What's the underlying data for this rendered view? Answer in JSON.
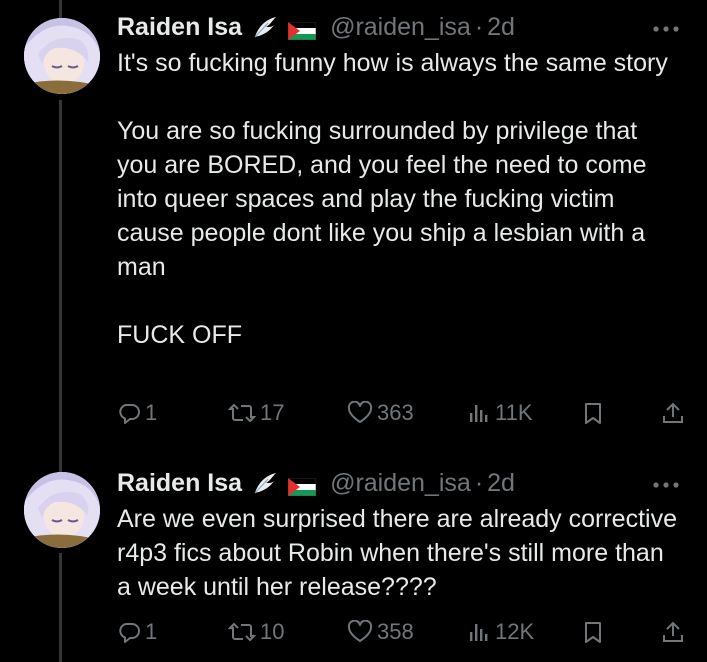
{
  "tweets": [
    {
      "name": "Raiden Isa",
      "handle": "@raiden_isa",
      "separator": "·",
      "time": "2d",
      "text": "It's so fucking funny how is always the same story\n\nYou are so fucking surrounded by privilege that you are BORED, and you feel the need to come into queer spaces and play the fucking victim cause people dont like you ship a lesbian with a man\n\nFUCK OFF",
      "replies": "1",
      "reposts": "17",
      "likes": "363",
      "views": "11K"
    },
    {
      "name": "Raiden Isa",
      "handle": "@raiden_isa",
      "separator": "·",
      "time": "2d",
      "text": "Are we even surprised there are already corrective r4p3 fics about Robin when there's still more than a week until her release????",
      "replies": "1",
      "reposts": "10",
      "likes": "358",
      "views": "12K"
    }
  ],
  "icons": [
    "verified-wing-icon",
    "palestine-flag-icon",
    "more-icon",
    "reply-icon",
    "repost-icon",
    "like-icon",
    "views-icon",
    "bookmark-icon",
    "share-icon"
  ],
  "colors": {
    "background": "#000000",
    "text": "#e7e9ea",
    "muted": "#71767b",
    "thread_line": "#333639"
  }
}
